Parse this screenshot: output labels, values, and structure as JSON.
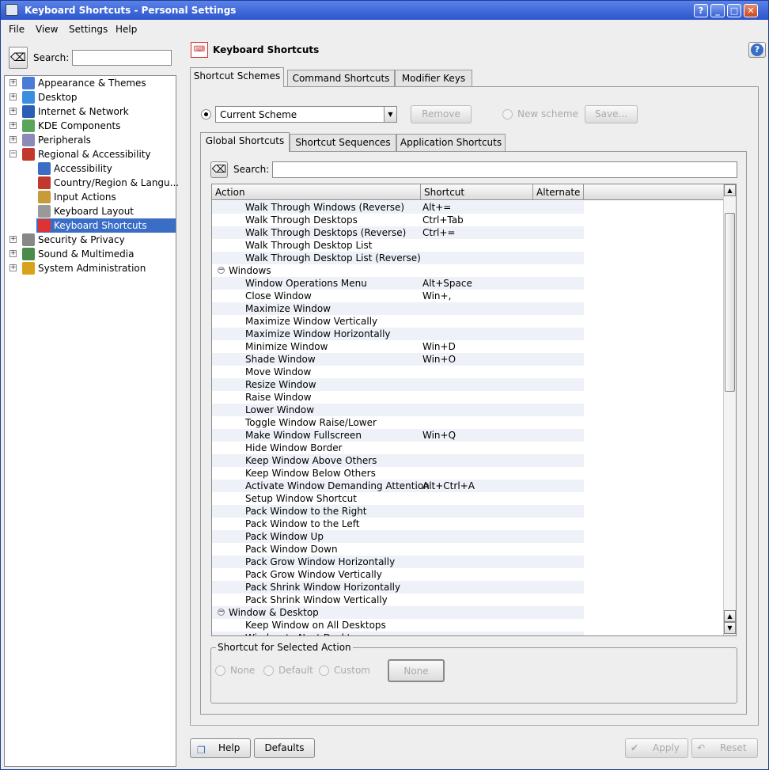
{
  "window": {
    "title": "Keyboard Shortcuts - Personal Settings"
  },
  "menu": [
    "File",
    "View",
    "Settings",
    "Help"
  ],
  "sidebar": {
    "search_label": "Search:",
    "items": [
      {
        "label": "Appearance & Themes",
        "icon": "appearance-themes-icon",
        "level": 0,
        "expander": "+"
      },
      {
        "label": "Desktop",
        "icon": "desktop-icon",
        "level": 0,
        "expander": "+"
      },
      {
        "label": "Internet & Network",
        "icon": "network-globe-icon",
        "level": 0,
        "expander": "+"
      },
      {
        "label": "KDE Components",
        "icon": "kde-components-icon",
        "level": 0,
        "expander": "+"
      },
      {
        "label": "Peripherals",
        "icon": "peripherals-icon",
        "level": 0,
        "expander": "+"
      },
      {
        "label": "Regional & Accessibility",
        "icon": "regional-flag-icon",
        "level": 0,
        "expander": "−"
      },
      {
        "label": "Accessibility",
        "icon": "accessibility-icon",
        "level": 1
      },
      {
        "label": "Country/Region & Langu...",
        "icon": "country-flag-icon",
        "level": 1
      },
      {
        "label": "Input Actions",
        "icon": "input-actions-icon",
        "level": 1
      },
      {
        "label": "Keyboard Layout",
        "icon": "keyboard-layout-icon",
        "level": 1
      },
      {
        "label": "Keyboard Shortcuts",
        "icon": "keyboard-shortcuts-icon",
        "level": 1,
        "selected": true
      },
      {
        "label": "Security & Privacy",
        "icon": "security-key-icon",
        "level": 0,
        "expander": "+"
      },
      {
        "label": "Sound & Multimedia",
        "icon": "sound-speaker-icon",
        "level": 0,
        "expander": "+"
      },
      {
        "label": "System Administration",
        "icon": "system-admin-icon",
        "level": 0,
        "expander": "+"
      }
    ]
  },
  "page": {
    "title": "Keyboard Shortcuts",
    "tabs": [
      "Shortcut Schemes",
      "Command Shortcuts",
      "Modifier Keys"
    ],
    "scheme": {
      "current": "Current Scheme",
      "remove": "Remove",
      "new_scheme": "New scheme",
      "save": "Save..."
    },
    "subtabs": [
      "Global Shortcuts",
      "Shortcut Sequences",
      "Application Shortcuts"
    ],
    "search_label": "Search:",
    "columns": [
      "Action",
      "Shortcut",
      "Alternate"
    ],
    "rows": [
      {
        "a": "Walk Through Windows (Reverse)",
        "s": "Alt+="
      },
      {
        "a": "Walk Through Desktops",
        "s": "Ctrl+Tab"
      },
      {
        "a": "Walk Through Desktops (Reverse)",
        "s": "Ctrl+="
      },
      {
        "a": "Walk Through Desktop List",
        "s": ""
      },
      {
        "a": "Walk Through Desktop List (Reverse)",
        "s": ""
      },
      {
        "a": "Windows",
        "s": "",
        "group": true
      },
      {
        "a": "Window Operations Menu",
        "s": "Alt+Space"
      },
      {
        "a": "Close Window",
        "s": "Win+,"
      },
      {
        "a": "Maximize Window",
        "s": ""
      },
      {
        "a": "Maximize Window Vertically",
        "s": ""
      },
      {
        "a": "Maximize Window Horizontally",
        "s": ""
      },
      {
        "a": "Minimize Window",
        "s": "Win+D"
      },
      {
        "a": "Shade Window",
        "s": "Win+O"
      },
      {
        "a": "Move Window",
        "s": ""
      },
      {
        "a": "Resize Window",
        "s": ""
      },
      {
        "a": "Raise Window",
        "s": ""
      },
      {
        "a": "Lower Window",
        "s": ""
      },
      {
        "a": "Toggle Window Raise/Lower",
        "s": ""
      },
      {
        "a": "Make Window Fullscreen",
        "s": "Win+Q"
      },
      {
        "a": "Hide Window Border",
        "s": ""
      },
      {
        "a": "Keep Window Above Others",
        "s": ""
      },
      {
        "a": "Keep Window Below Others",
        "s": ""
      },
      {
        "a": "Activate Window Demanding Attention",
        "s": "Alt+Ctrl+A"
      },
      {
        "a": "Setup Window Shortcut",
        "s": ""
      },
      {
        "a": "Pack Window to the Right",
        "s": ""
      },
      {
        "a": "Pack Window to the Left",
        "s": ""
      },
      {
        "a": "Pack Window Up",
        "s": ""
      },
      {
        "a": "Pack Window Down",
        "s": ""
      },
      {
        "a": "Pack Grow Window Horizontally",
        "s": ""
      },
      {
        "a": "Pack Grow Window Vertically",
        "s": ""
      },
      {
        "a": "Pack Shrink Window Horizontally",
        "s": ""
      },
      {
        "a": "Pack Shrink Window Vertically",
        "s": ""
      },
      {
        "a": "Window & Desktop",
        "s": "",
        "group": true
      },
      {
        "a": "Keep Window on All Desktops",
        "s": ""
      },
      {
        "a": "Window to Next Desktop",
        "s": ""
      }
    ],
    "selected_action": {
      "title": "Shortcut for Selected Action",
      "none": "None",
      "default": "Default",
      "custom": "Custom",
      "button": "None"
    }
  },
  "footer": {
    "help": "Help",
    "defaults": "Defaults",
    "apply": "Apply",
    "reset": "Reset"
  },
  "colors": {
    "titlebar": "#2c55cc",
    "selection": "#3a6ec6",
    "row_alt": "#eef1f8"
  }
}
